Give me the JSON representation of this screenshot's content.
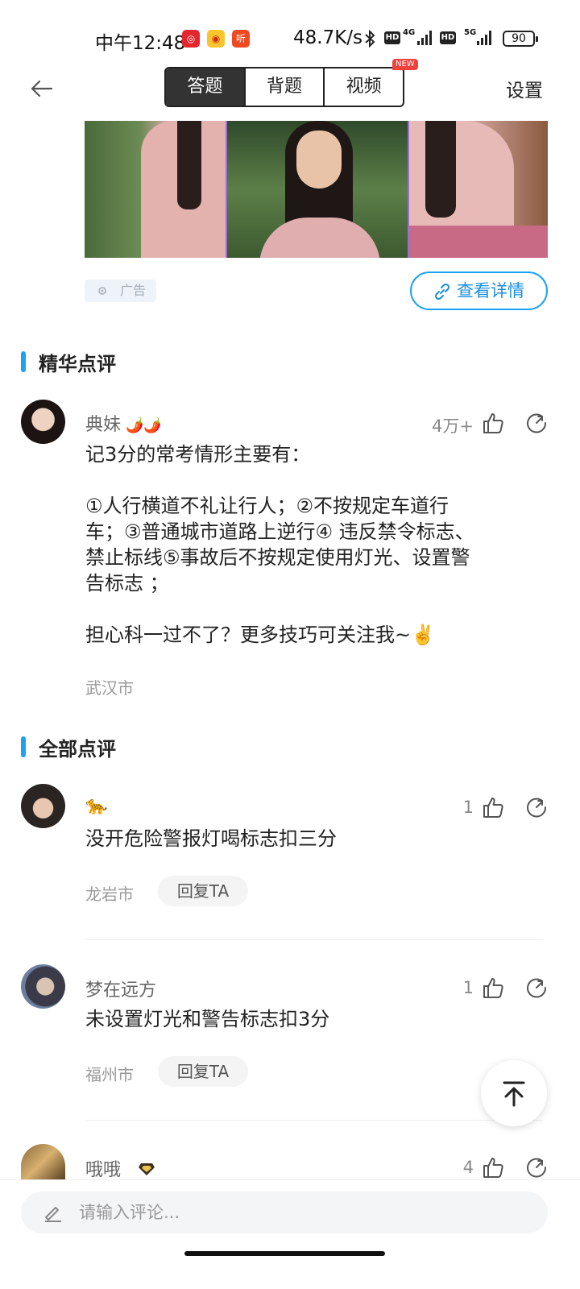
{
  "status_bar": {
    "time": "中午12:48",
    "app_icons": [
      {
        "name": "netease-music-icon",
        "glyph": "◎",
        "color": "#e6262e"
      },
      {
        "name": "weibo-icon",
        "glyph": "◉",
        "color": "#f7c52c"
      },
      {
        "name": "listen-icon",
        "glyph": "听",
        "color": "#f04a22"
      }
    ],
    "net_speed": "48.7K/s",
    "hd1": "HD",
    "net1": "4G",
    "hd2": "HD",
    "net2": "5G",
    "battery": "90"
  },
  "header": {
    "tabs": [
      {
        "label": "答题",
        "active": true
      },
      {
        "label": "背题",
        "active": false
      },
      {
        "label": "视频",
        "active": false
      }
    ],
    "new_badge": "NEW",
    "settings_label": "设置"
  },
  "ad": {
    "tag_label": "广告",
    "detail_button": "查看详情"
  },
  "featured": {
    "section_title": "精华点评",
    "comment": {
      "username": "典妹",
      "name_badge": "🌶️🌶️",
      "likes": "4万+",
      "lines": [
        "记3分的常考情形主要有：",
        "",
        "①人行横道不礼让行人；②不按规定车道行",
        "车；③普通城市道路上逆行④ 违反禁令标志、",
        "禁止标线⑤事故后不按规定使用灯光、设置警",
        "告标志 ；",
        "",
        "担心科一过不了？更多技巧可关注我~✌️"
      ],
      "city": "武汉市"
    }
  },
  "all_comments": {
    "section_title": "全部点评",
    "reply_label": "回复TA",
    "comments": [
      {
        "username": "🐆",
        "likes": "1",
        "text": "没开危险警报灯喝标志扣三分",
        "city": "龙岩市"
      },
      {
        "username": "梦在远方",
        "likes": "1",
        "text": "未设置灯光和警告标志扣3分",
        "city": "福州市"
      },
      {
        "username": "哦哦",
        "likes": "4",
        "text": "",
        "city": ""
      }
    ]
  },
  "bottom": {
    "input_placeholder": "请输入评论..."
  },
  "colors": {
    "accent": "#1da1f2",
    "active_tab": "#333333",
    "new_badge": "#f0413a"
  }
}
